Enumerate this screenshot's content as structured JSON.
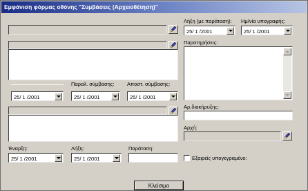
{
  "window": {
    "title": "Εμφάνιση φόρμας οθόνης \"Συμβάσεις (Αρχειοθέτηση)\""
  },
  "fields": {
    "end_by_extension_label": "Λήξη (με παράταση):",
    "end_by_extension_value": "25/ 1 /2001",
    "signing_date_label": "Ημ/νία υπογραφής:",
    "signing_date_value": "25/ 1 /2001",
    "notes_label": "Παρατηρήσεις:",
    "contract_date_value": "25/ 1 /2001",
    "receipt_date_label": "Παραλ. σύμβασης:",
    "receipt_date_value": "25/ 1 /2001",
    "send_date_label": "Αποστ. σύμβασης:",
    "send_date_value": "25/ 1 /2001",
    "protocol_no_label": "Αρ.διακήρυξης:",
    "authority_label": "Αρχή:",
    "start_label": "Έναρξη:",
    "start_value": "25/ 1 /2001",
    "end_label": "Λήξη:",
    "end_value": "25/ 1 /2001",
    "extension_label": "Παράταση:",
    "exemption_label": "Εξαιρείς υπογεγραμένο:"
  },
  "actions": {
    "close_label": "Κλείσιμο"
  },
  "icons": {
    "edit": "pencil-edit-icon",
    "dropdown": "chevron-down-icon"
  },
  "colors": {
    "title_gradient_start": "#1a2d86",
    "title_gradient_end": "#b7c4e3",
    "window_bg": "#d4d0c8",
    "field_bg": "#ffffff"
  }
}
